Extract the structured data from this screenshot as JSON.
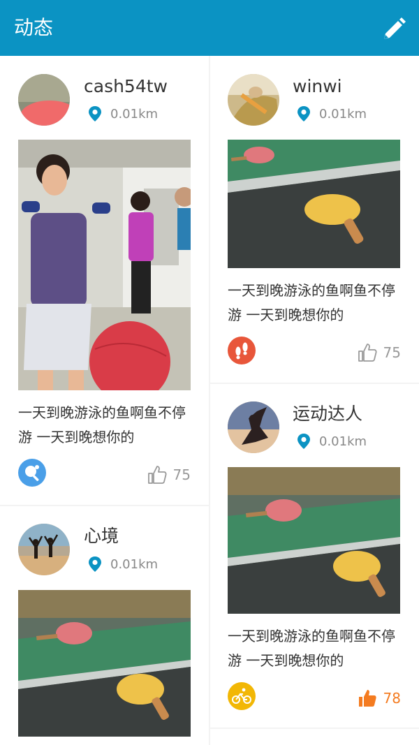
{
  "header": {
    "title": "动态"
  },
  "posts": [
    {
      "username": "cash54tw",
      "distance": "0.01km",
      "text": "一天到晚游泳的鱼啊鱼不停游 一天到晚想你的",
      "likes": "75",
      "category_icon": "ping-pong-icon",
      "liked": false
    },
    {
      "username": "winwi",
      "distance": "0.01km",
      "text": "一天到晚游泳的鱼啊鱼不停游 一天到晚想你的",
      "likes": "75",
      "category_icon": "footprints-icon",
      "liked": false
    },
    {
      "username": "心境",
      "distance": "0.01km",
      "text": "",
      "likes": "",
      "category_icon": "",
      "liked": false
    },
    {
      "username": "运动达人",
      "distance": "0.01km",
      "text": "一天到晚游泳的鱼啊鱼不停游 一天到晚想你的",
      "likes": "78",
      "category_icon": "cycling-icon",
      "liked": true
    }
  ],
  "colors": {
    "header": "#0b93c3",
    "pin": "#0b93c3",
    "liked": "#f47b20",
    "ping_pong_badge": "#4a9fe8",
    "footprints_badge": "#e8563a",
    "cycling_badge": "#f2b705"
  }
}
